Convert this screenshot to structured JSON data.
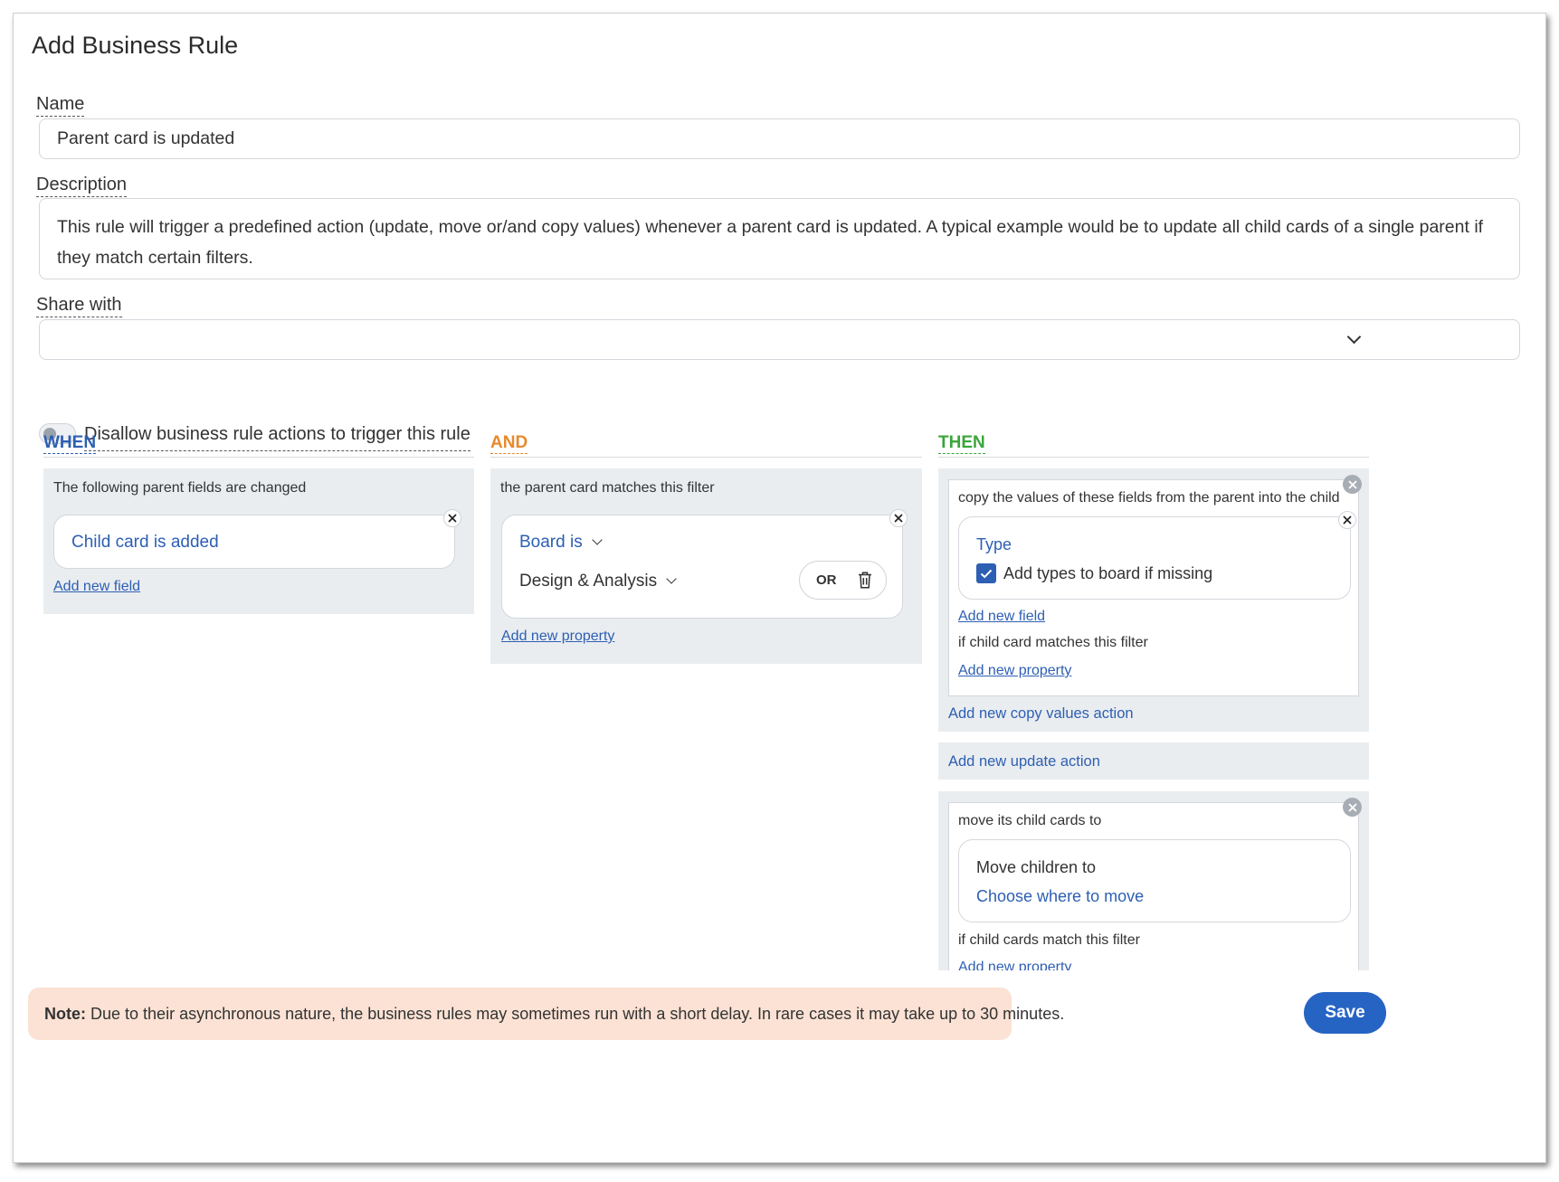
{
  "dialog": {
    "title": "Add Business Rule"
  },
  "name": {
    "label": "Name",
    "value": "Parent card is updated"
  },
  "description": {
    "label": "Description",
    "value": "This rule will trigger a predefined action (update, move or/and copy values) whenever a parent card is updated. A typical example would be to update all child cards of a single parent if they match certain filters."
  },
  "share": {
    "label": "Share with",
    "value": ""
  },
  "toggle": {
    "label": "Disallow business rule actions to trigger this rule",
    "checked": false
  },
  "when": {
    "heading": "WHEN",
    "color": "#2d5fb3",
    "panel_title": "The following parent fields are changed",
    "fields": [
      {
        "label": "Child card is added"
      }
    ],
    "add_link": "Add new field"
  },
  "and": {
    "heading": "AND",
    "color": "#e8892c",
    "panel_title": "the parent card matches this filter",
    "filter": {
      "property": "Board is",
      "value": "Design & Analysis",
      "or_label": "OR"
    },
    "add_link": "Add new property"
  },
  "then": {
    "heading": "THEN",
    "color": "#3aa53a",
    "copy": {
      "title": "copy the values of these fields from the parent into the child",
      "field": {
        "name": "Type",
        "checkbox_label": "Add types to board if missing",
        "checked": true
      },
      "add_field_link": "Add new field",
      "filter_title": "if child card matches this filter",
      "add_property_link": "Add new property",
      "add_action": "Add new copy values action"
    },
    "update": {
      "add_action": "Add new update action"
    },
    "move": {
      "title": "move its child cards to",
      "card_title": "Move children to",
      "card_link": "Choose where to move",
      "filter_title": "if child cards match this filter",
      "add_property_link": "Add new property"
    }
  },
  "footer": {
    "note_label": "Note:",
    "note_text": "Due to their asynchronous nature, the business rules may sometimes run with a short delay. In rare cases it may take up to 30 minutes.",
    "save_label": "Save"
  }
}
